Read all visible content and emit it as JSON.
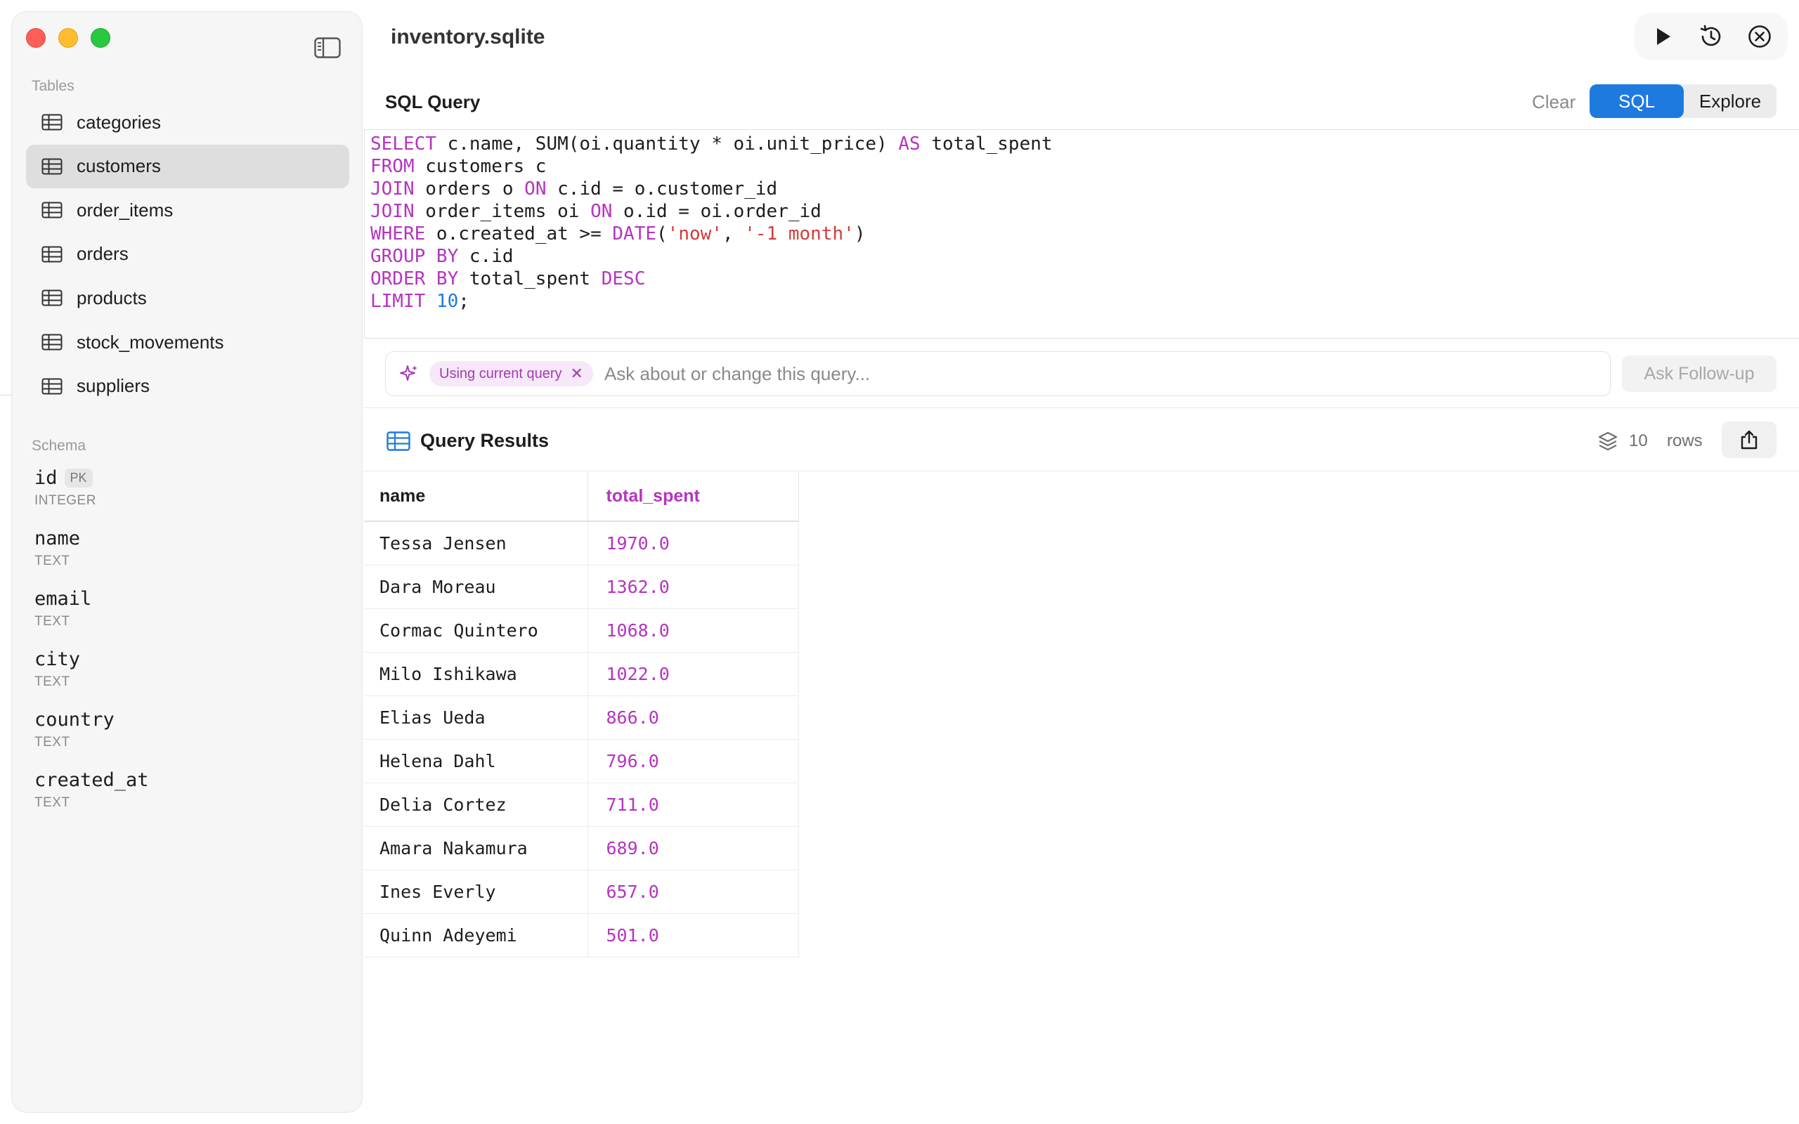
{
  "window": {
    "title": "inventory.sqlite"
  },
  "sidebar": {
    "tables_label": "Tables",
    "tables": [
      {
        "label": "categories",
        "selected": false
      },
      {
        "label": "customers",
        "selected": true
      },
      {
        "label": "order_items",
        "selected": false
      },
      {
        "label": "orders",
        "selected": false
      },
      {
        "label": "products",
        "selected": false
      },
      {
        "label": "stock_movements",
        "selected": false
      },
      {
        "label": "suppliers",
        "selected": false
      }
    ],
    "schema_label": "Schema",
    "schema": [
      {
        "name": "id",
        "type": "INTEGER",
        "badge": "PK"
      },
      {
        "name": "name",
        "type": "TEXT"
      },
      {
        "name": "email",
        "type": "TEXT"
      },
      {
        "name": "city",
        "type": "TEXT"
      },
      {
        "name": "country",
        "type": "TEXT"
      },
      {
        "name": "created_at",
        "type": "TEXT"
      }
    ]
  },
  "query_panel": {
    "title": "SQL Query",
    "clear_label": "Clear",
    "mode_sql_label": "SQL",
    "mode_explore_label": "Explore",
    "active_mode": "SQL",
    "sql_lines": [
      [
        [
          "kw",
          "SELECT"
        ],
        [
          "t",
          " c.name, SUM(oi.quantity * oi.unit_price) "
        ],
        [
          "kw",
          "AS"
        ],
        [
          "t",
          " total_spent"
        ]
      ],
      [
        [
          "kw",
          "FROM"
        ],
        [
          "t",
          " customers c"
        ]
      ],
      [
        [
          "kw",
          "JOIN"
        ],
        [
          "t",
          " orders o "
        ],
        [
          "kw",
          "ON"
        ],
        [
          "t",
          " c.id = o.customer_id"
        ]
      ],
      [
        [
          "kw",
          "JOIN"
        ],
        [
          "t",
          " order_items oi "
        ],
        [
          "kw",
          "ON"
        ],
        [
          "t",
          " o.id = oi.order_id"
        ]
      ],
      [
        [
          "kw",
          "WHERE"
        ],
        [
          "t",
          " o.created_at >= "
        ],
        [
          "kw",
          "DATE"
        ],
        [
          "t",
          "("
        ],
        [
          "str",
          "'now'"
        ],
        [
          "t",
          ", "
        ],
        [
          "str",
          "'-1 month'"
        ],
        [
          "t",
          ")"
        ]
      ],
      [
        [
          "kw",
          "GROUP BY"
        ],
        [
          "t",
          " c.id"
        ]
      ],
      [
        [
          "kw",
          "ORDER BY"
        ],
        [
          "t",
          " total_spent "
        ],
        [
          "kw",
          "DESC"
        ]
      ],
      [
        [
          "kw",
          "LIMIT"
        ],
        [
          "t",
          " "
        ],
        [
          "num",
          "10"
        ],
        [
          "t",
          ";"
        ]
      ]
    ]
  },
  "ask": {
    "chip_label": "Using current query",
    "placeholder": "Ask about or change this query...",
    "value": "",
    "followup_label": "Ask Follow-up"
  },
  "results": {
    "title": "Query Results",
    "row_count": "10",
    "rows_label": "rows",
    "columns": [
      "name",
      "total_spent"
    ],
    "rows": [
      [
        "Tessa Jensen",
        "1970.0"
      ],
      [
        "Dara Moreau",
        "1362.0"
      ],
      [
        "Cormac Quintero",
        "1068.0"
      ],
      [
        "Milo Ishikawa",
        "1022.0"
      ],
      [
        "Elias Ueda",
        "866.0"
      ],
      [
        "Helena Dahl",
        "796.0"
      ],
      [
        "Delia Cortez",
        "711.0"
      ],
      [
        "Amara Nakamura",
        "689.0"
      ],
      [
        "Ines Everly",
        "657.0"
      ],
      [
        "Quinn Adeyemi",
        "501.0"
      ]
    ]
  },
  "toolbar": {
    "icons": [
      "play-icon",
      "history-icon",
      "close-circle-icon"
    ]
  },
  "colors": {
    "accent": "#1f7ae0",
    "keyword": "#b634c0",
    "string": "#d23a3a",
    "number": "#1f7ae0",
    "selected_row": "#dedede",
    "close": "#ff5f57",
    "minimize": "#febc2e",
    "zoom": "#28c840"
  }
}
